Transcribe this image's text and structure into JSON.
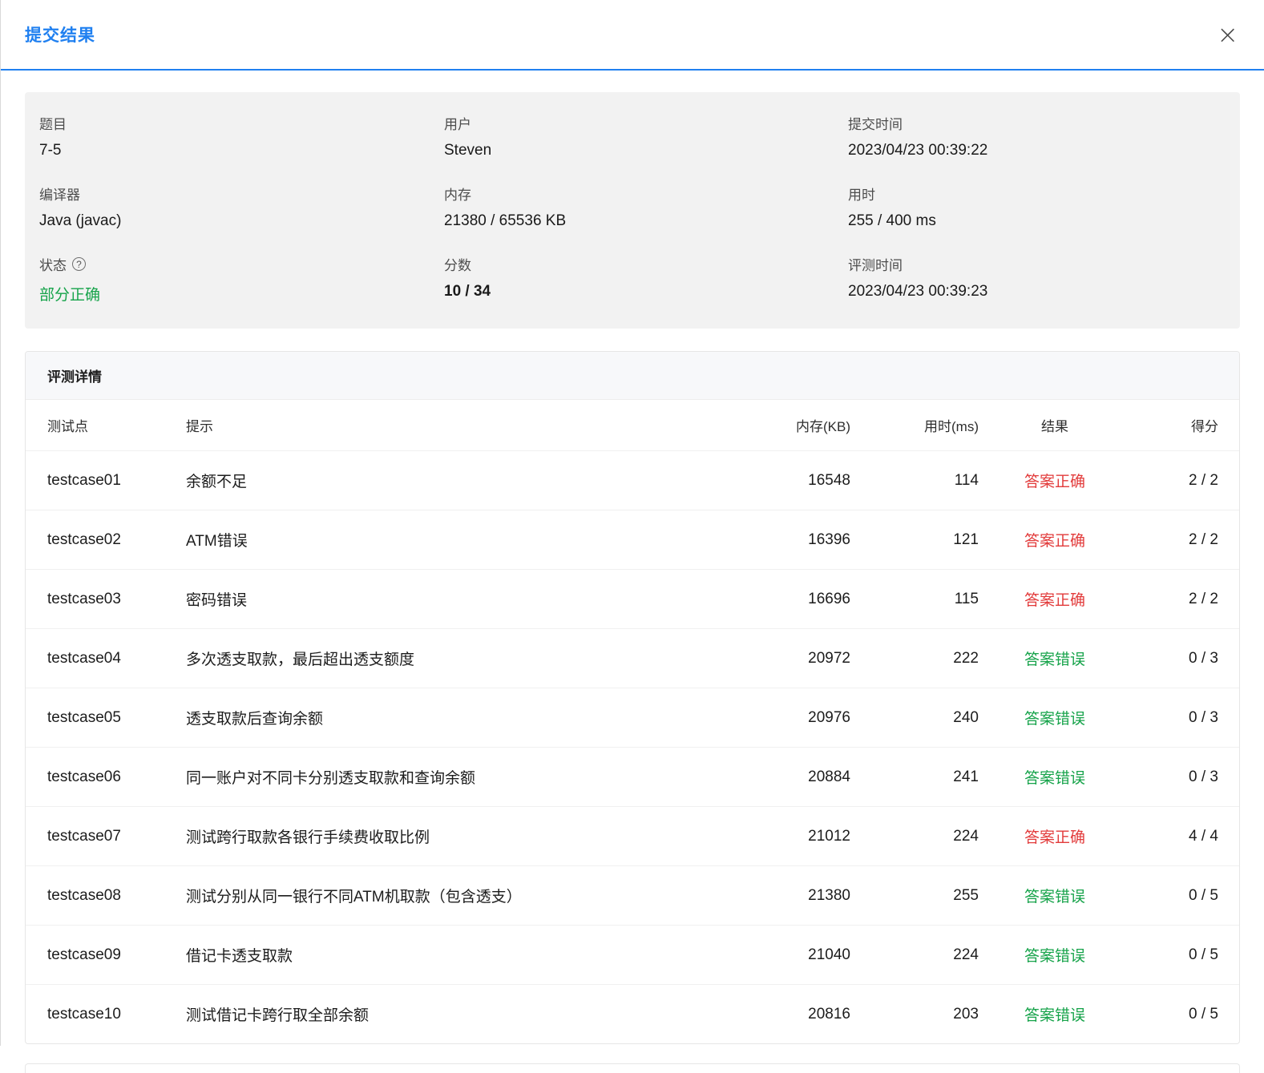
{
  "modal": {
    "title": "提交结果"
  },
  "icons": {
    "close": "×",
    "help": "?"
  },
  "colors": {
    "accent": "#2080f0",
    "green": "#16a34a",
    "red": "#e23b3b"
  },
  "summary": {
    "fields": [
      {
        "label": "题目",
        "value": "7-5"
      },
      {
        "label": "用户",
        "value": "Steven"
      },
      {
        "label": "提交时间",
        "value": "2023/04/23 00:39:22"
      },
      {
        "label": "编译器",
        "value": "Java (javac)"
      },
      {
        "label": "内存",
        "value": "21380 / 65536 KB"
      },
      {
        "label": "用时",
        "value": "255 / 400 ms"
      },
      {
        "label": "状态",
        "value": "部分正确",
        "value_class": "green"
      },
      {
        "label": "分数",
        "value": "10 / 34",
        "value_class": "bold"
      },
      {
        "label": "评测时间",
        "value": "2023/04/23 00:39:23"
      }
    ]
  },
  "details": {
    "title": "评测详情",
    "columns": [
      "测试点",
      "提示",
      "内存(KB)",
      "用时(ms)",
      "结果",
      "得分"
    ],
    "rows": [
      {
        "testcase": "testcase01",
        "hint": "余额不足",
        "memory": "16548",
        "time": "114",
        "result": "答案正确",
        "result_type": "correct",
        "score": "2 / 2"
      },
      {
        "testcase": "testcase02",
        "hint": "ATM错误",
        "memory": "16396",
        "time": "121",
        "result": "答案正确",
        "result_type": "correct",
        "score": "2 / 2"
      },
      {
        "testcase": "testcase03",
        "hint": "密码错误",
        "memory": "16696",
        "time": "115",
        "result": "答案正确",
        "result_type": "correct",
        "score": "2 / 2"
      },
      {
        "testcase": "testcase04",
        "hint": "多次透支取款，最后超出透支额度",
        "memory": "20972",
        "time": "222",
        "result": "答案错误",
        "result_type": "wrong",
        "score": "0 / 3"
      },
      {
        "testcase": "testcase05",
        "hint": "透支取款后查询余额",
        "memory": "20976",
        "time": "240",
        "result": "答案错误",
        "result_type": "wrong",
        "score": "0 / 3"
      },
      {
        "testcase": "testcase06",
        "hint": "同一账户对不同卡分别透支取款和查询余额",
        "memory": "20884",
        "time": "241",
        "result": "答案错误",
        "result_type": "wrong",
        "score": "0 / 3"
      },
      {
        "testcase": "testcase07",
        "hint": "测试跨行取款各银行手续费收取比例",
        "memory": "21012",
        "time": "224",
        "result": "答案正确",
        "result_type": "correct",
        "score": "4 / 4"
      },
      {
        "testcase": "testcase08",
        "hint": "测试分别从同一银行不同ATM机取款（包含透支）",
        "memory": "21380",
        "time": "255",
        "result": "答案错误",
        "result_type": "wrong",
        "score": "0 / 5"
      },
      {
        "testcase": "testcase09",
        "hint": "借记卡透支取款",
        "memory": "21040",
        "time": "224",
        "result": "答案错误",
        "result_type": "wrong",
        "score": "0 / 5"
      },
      {
        "testcase": "testcase10",
        "hint": "测试借记卡跨行取全部余额",
        "memory": "20816",
        "time": "203",
        "result": "答案错误",
        "result_type": "wrong",
        "score": "0 / 5"
      }
    ]
  }
}
